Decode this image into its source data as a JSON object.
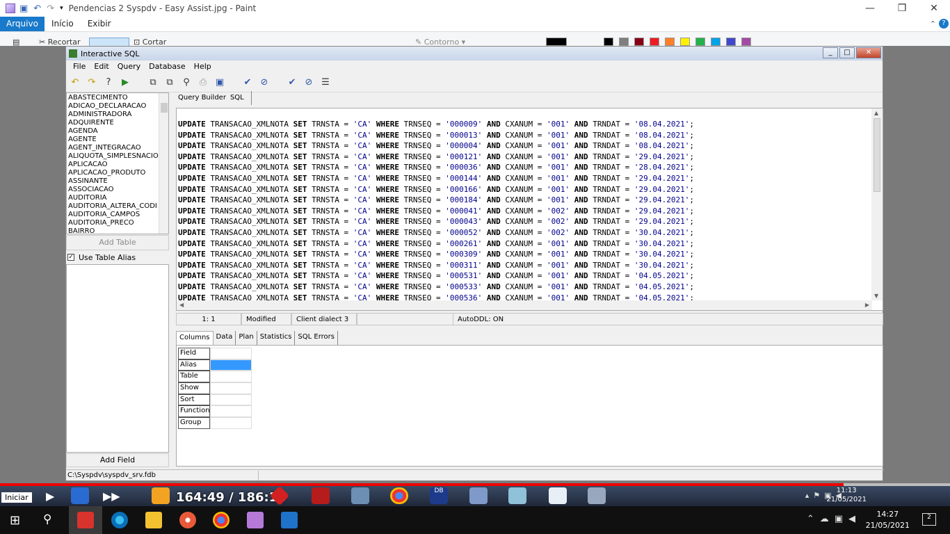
{
  "paint": {
    "title": "Pendencias 2 Syspdv - Easy Assist.jpg - Paint",
    "tabs": [
      "Arquivo",
      "Início",
      "Exibir"
    ],
    "ribbon": {
      "recortar": "Recortar",
      "cortar": "Cortar",
      "contorno": "Contorno"
    },
    "window_controls": [
      "—",
      "❐",
      "✕"
    ]
  },
  "isql": {
    "title": "Interactive SQL",
    "menu": [
      "File",
      "Edit",
      "Query",
      "Database",
      "Help"
    ],
    "tables": [
      "ABASTECIMENTO",
      "ADICAO_DECLARACAO",
      "ADMINISTRADORA",
      "ADQUIRENTE",
      "AGENDA",
      "AGENTE",
      "AGENT_INTEGRACAO",
      "ALIQUOTA_SIMPLESNACIO",
      "APLICACAO",
      "APLICACAO_PRODUTO",
      "ASSINANTE",
      "ASSOCIACAO",
      "AUDITORIA",
      "AUDITORIA_ALTERA_CODI",
      "AUDITORIA_CAMPOS",
      "AUDITORIA_PRECO",
      "BAIRRO"
    ],
    "add_table": "Add Table",
    "use_alias": "Use Table Alias",
    "add_field": "Add Field",
    "path": "C:\\Syspdv\\syspdv_srv.fdb",
    "query_tabs": [
      "Query Builder",
      "SQL"
    ],
    "sql_rows": [
      {
        "seq": "000009",
        "cx": "001",
        "dat": "08.04.2021"
      },
      {
        "seq": "000013",
        "cx": "001",
        "dat": "08.04.2021"
      },
      {
        "seq": "000004",
        "cx": "001",
        "dat": "08.04.2021"
      },
      {
        "seq": "000121",
        "cx": "001",
        "dat": "29.04.2021"
      },
      {
        "seq": "000036",
        "cx": "001",
        "dat": "28.04.2021"
      },
      {
        "seq": "000144",
        "cx": "001",
        "dat": "29.04.2021"
      },
      {
        "seq": "000166",
        "cx": "001",
        "dat": "29.04.2021"
      },
      {
        "seq": "000184",
        "cx": "001",
        "dat": "29.04.2021"
      },
      {
        "seq": "000041",
        "cx": "002",
        "dat": "29.04.2021"
      },
      {
        "seq": "000043",
        "cx": "002",
        "dat": "29.04.2021"
      },
      {
        "seq": "000052",
        "cx": "002",
        "dat": "30.04.2021"
      },
      {
        "seq": "000261",
        "cx": "001",
        "dat": "30.04.2021"
      },
      {
        "seq": "000309",
        "cx": "001",
        "dat": "30.04.2021"
      },
      {
        "seq": "000311",
        "cx": "001",
        "dat": "30.04.2021"
      },
      {
        "seq": "000531",
        "cx": "001",
        "dat": "04.05.2021"
      },
      {
        "seq": "000533",
        "cx": "001",
        "dat": "04.05.2021"
      },
      {
        "seq": "000536",
        "cx": "001",
        "dat": "04.05.2021"
      }
    ],
    "sql_tokens": {
      "update": "UPDATE",
      "table": "TRANSACAO_XMLNOTA",
      "set": "SET",
      "col": "TRNSTA",
      "val": "'CA'",
      "where": "WHERE",
      "seqcol": "TRNSEQ",
      "and": "AND",
      "cxcol": "CXANUM",
      "datcol": "TRNDAT"
    },
    "status": {
      "pos": "1:  1",
      "state": "Modified",
      "dialect": "Client dialect 3",
      "autoddl": "AutoDDL: ON"
    },
    "result_tabs": [
      "Columns",
      "Data",
      "Plan",
      "Statistics",
      "SQL Errors"
    ],
    "grid_rows": [
      "Field",
      "Alias",
      "Table",
      "Show",
      "Sort",
      "Function",
      "Group"
    ]
  },
  "video": {
    "start": "Iniciar",
    "timecode": "164:49 / 186:18",
    "clock_time": "11:13",
    "clock_date": "21/05/2021",
    "progress_fraction": 0.888
  },
  "win10": {
    "clock_time": "14:27",
    "clock_date": "21/05/2021",
    "notifications": "2"
  }
}
